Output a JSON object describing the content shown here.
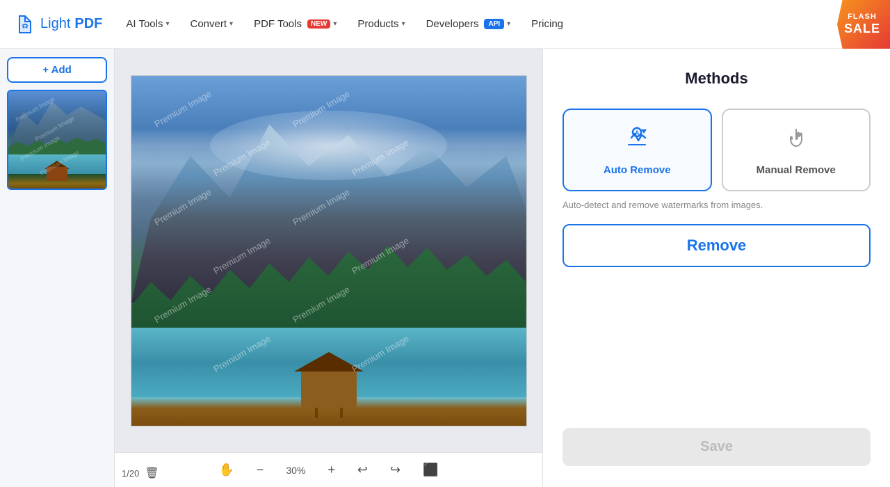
{
  "nav": {
    "logo": "LightPDF",
    "logo_light": "Light",
    "logo_pdf": "PDF",
    "items": [
      {
        "label": "AI Tools",
        "has_chevron": true
      },
      {
        "label": "Convert",
        "has_chevron": true
      },
      {
        "label": "PDF Tools",
        "badge": "NEW",
        "has_chevron": true
      },
      {
        "label": "Products",
        "has_chevron": true
      },
      {
        "label": "Developers",
        "badge": "API",
        "has_chevron": true
      }
    ],
    "pricing": "Pricing",
    "flash_line1": "FLASH",
    "flash_line2": "SALE"
  },
  "sidebar": {
    "add_btn": "+ Add",
    "page_count": "1/20"
  },
  "toolbar": {
    "zoom_percent": "30%",
    "zoom_in": "+",
    "zoom_out": "−"
  },
  "right_panel": {
    "title": "Methods",
    "auto_remove_label": "Auto Remove",
    "manual_remove_label": "Manual Remove",
    "description": "Auto-detect and remove watermarks from images.",
    "remove_btn": "Remove",
    "save_btn": "Save"
  }
}
